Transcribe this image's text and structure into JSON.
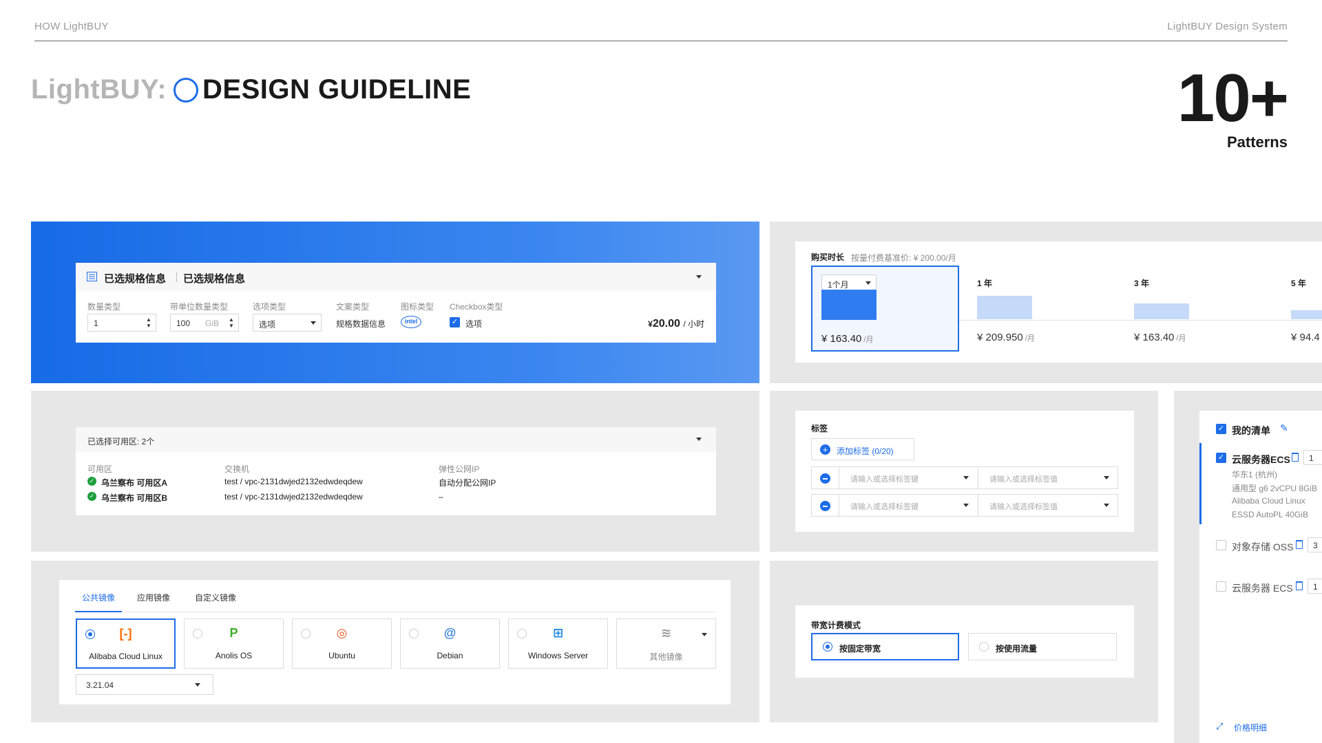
{
  "header": {
    "left": "HOW LightBUY",
    "right": "LightBUY Design System"
  },
  "hero": {
    "brand": "LightBUY:",
    "title": "DESIGN GUIDELINE",
    "count": "10+",
    "count_label": "Patterns"
  },
  "spec": {
    "title_a": "已选规格信息",
    "title_b": "已选规格信息",
    "f1_label": "数量类型",
    "f1_value": "1",
    "f2_label": "带单位数量类型",
    "f2_value": "100",
    "f2_unit": "GiB",
    "f3_label": "选项类型",
    "f3_value": "选项",
    "f4_label": "文案类型",
    "f4_value": "规格数据信息",
    "f5_label": "图标类型",
    "f5_icon": "intel",
    "f6_label": "Checkbox类型",
    "f6_value": "选项",
    "price_symbol": "¥",
    "price": "20.00",
    "price_unit": "/ 小时"
  },
  "duration": {
    "label": "购买时长",
    "hint": "按量付费基准价: ¥ 200.00/月",
    "select": "1个月",
    "options": [
      {
        "label": "1个月",
        "price": "¥ 163.40",
        "unit": "/月",
        "level": 1.0
      },
      {
        "label": "1 年",
        "price": "¥ 209.950",
        "unit": "/月",
        "level": 0.78
      },
      {
        "label": "3 年",
        "price": "¥ 163.40",
        "unit": "/月",
        "level": 0.53
      },
      {
        "label": "5 年",
        "price": "¥ 94.4",
        "unit": "",
        "level": 0.3
      }
    ]
  },
  "zones": {
    "header": "已选择可用区: 2个",
    "col1": "可用区",
    "col2": "交换机",
    "col3": "弹性公网IP",
    "rows": [
      {
        "zone": "乌兰察布 可用区A",
        "vsw": "test / vpc-2131dwjed2132edwdeqdew",
        "ip": "自动分配公网IP"
      },
      {
        "zone": "乌兰察布 可用区B",
        "vsw": "test / vpc-2131dwjed2132edwdeqdew",
        "ip": "–"
      }
    ]
  },
  "tags": {
    "label": "标签",
    "add": "添加标签 (0/20)",
    "key_placeholder": "请输入或选择标签键",
    "value_placeholder": "请输入或选择标签值"
  },
  "cart": {
    "title": "我的清单",
    "items": [
      {
        "name": "云服务器ECS",
        "qty": "1",
        "checked": true,
        "details": [
          "华东1 (杭州)",
          "通用型 g6 2vCPU 8GiB",
          "Alibaba Cloud Linux",
          "ESSD AutoPL 40GiB"
        ]
      },
      {
        "name": "对象存储 OSS",
        "qty": "3",
        "checked": false
      },
      {
        "name": "云服务器 ECS",
        "qty": "1",
        "checked": false
      }
    ],
    "price_link": "价格明细"
  },
  "images": {
    "tabs": [
      "公共镜像",
      "应用镜像",
      "自定义镜像"
    ],
    "os": [
      {
        "name": "Alibaba Cloud Linux",
        "icon": "alibaba-cloud-icon",
        "color": "#ff6a00"
      },
      {
        "name": "Anolis OS",
        "icon": "anolis-icon",
        "color": "#3fae29"
      },
      {
        "name": "Ubuntu",
        "icon": "ubuntu-icon",
        "color": "#e95420"
      },
      {
        "name": "Debian",
        "icon": "debian-icon",
        "color": "#2f7ed8"
      },
      {
        "name": "Windows Server",
        "icon": "windows-icon",
        "color": "#1e88e5"
      },
      {
        "name": "其他镜像",
        "icon": "layers-icon",
        "color": "#999999"
      }
    ],
    "version": "3.21.04"
  },
  "bandwidth": {
    "label": "带宽计费模式",
    "opt1": "按固定带宽",
    "opt2": "按使用流量"
  },
  "colors": {
    "accent": "#1d6ce8",
    "panel": "#e7e7e7",
    "text": "#1f1f1f"
  }
}
